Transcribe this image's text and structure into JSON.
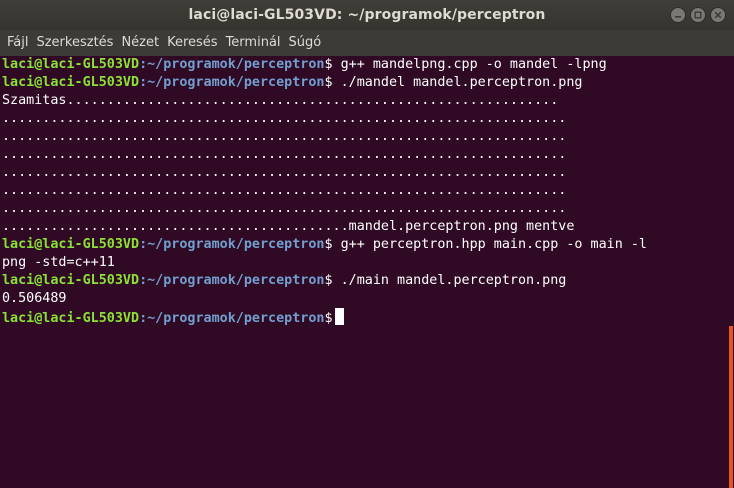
{
  "window": {
    "title": "laci@laci-GL503VD: ~/programok/perceptron"
  },
  "menubar": {
    "items": [
      "Fájl",
      "Szerkesztés",
      "Nézet",
      "Keresés",
      "Terminál",
      "Súgó"
    ]
  },
  "prompt": {
    "user_host": "laci@laci-GL503VD",
    "path": ":~/programok/perceptron",
    "symbol": "$"
  },
  "terminal": {
    "cmd1": " g++ mandelpng.cpp -o mandel -lpng",
    "cmd2": " ./mandel mandel.perceptron.png",
    "out1": "Szamitas.............................................................",
    "out2": "......................................................................",
    "out3": "......................................................................",
    "out4": "......................................................................",
    "out5": "......................................................................",
    "out6": "......................................................................",
    "out7": "......................................................................",
    "out8": "...........................................mandel.perceptron.png mentve",
    "cmd3": " g++ perceptron.hpp main.cpp -o main -l",
    "cmd3_wrap": "png -std=c++11",
    "cmd4": " ./main mandel.perceptron.png",
    "out9": "0.506489"
  },
  "icons": {
    "minimize": "minimize-icon",
    "maximize": "maximize-icon",
    "close": "close-icon"
  },
  "colors": {
    "background": "#300a24",
    "prompt_user": "#8ae234",
    "prompt_path": "#729fcf",
    "scrollbar": "#e95420"
  }
}
